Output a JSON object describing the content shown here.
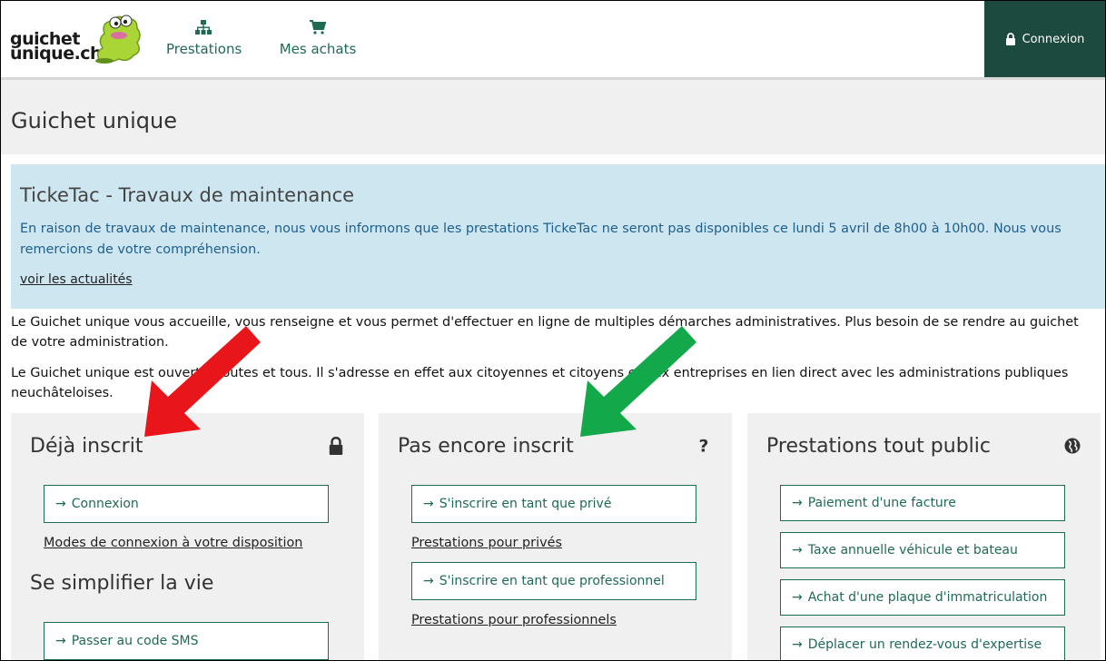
{
  "header": {
    "logo_line1": "guichet",
    "logo_line2": "unique.ch",
    "nav": [
      {
        "label": "Prestations",
        "icon": "sitemap-icon"
      },
      {
        "label": "Mes achats",
        "icon": "cart-icon"
      }
    ],
    "login_label": "Connexion",
    "colors": {
      "accent": "#1f6b4f",
      "login_bg": "#1d4a3e"
    }
  },
  "page": {
    "title": "Guichet unique"
  },
  "notice": {
    "title": "TickeTac - Travaux de maintenance",
    "text": "En raison de travaux de maintenance, nous vous informons que les prestations TickeTac ne seront pas disponibles ce lundi 5 avril de 8h00 à 10h00. Nous vous remercions de votre compréhension.",
    "link": "voir les actualités",
    "background": "#cde6f0"
  },
  "intro": {
    "p1": "Le Guichet unique vous accueille, vous renseigne et vous permet d'effectuer en ligne de multiples démarches administratives. Plus besoin de se rendre au guichet de votre administration.",
    "p2": "Le Guichet unique est ouvert à toutes et tous. Il s'adresse en effet aux citoyennes et citoyens et aux entreprises en lien direct avec les administrations publiques neuchâteloises."
  },
  "columns": {
    "registered": {
      "title": "Déjà inscrit",
      "icon": "lock-icon",
      "button": "Connexion",
      "link": "Modes de connexion à votre disposition",
      "sub_title": "Se simplifier la vie",
      "sub_button": "Passer au code SMS"
    },
    "not_registered": {
      "title": "Pas encore inscrit",
      "icon": "question-icon",
      "button_private": "S'inscrire en tant que privé",
      "link_private": "Prestations pour privés",
      "button_pro": "S'inscrire en tant que professionnel",
      "link_pro": "Prestations pour professionnels"
    },
    "public": {
      "title": "Prestations tout public",
      "icon": "globe-icon",
      "buttons": [
        "Paiement d'une facture",
        "Taxe annuelle véhicule et bateau",
        "Achat d'une plaque d'immatriculation",
        "Déplacer un rendez-vous d'expertise"
      ]
    }
  },
  "annotations": {
    "red_arrow_color": "#e8161b",
    "green_arrow_color": "#13a84a"
  }
}
